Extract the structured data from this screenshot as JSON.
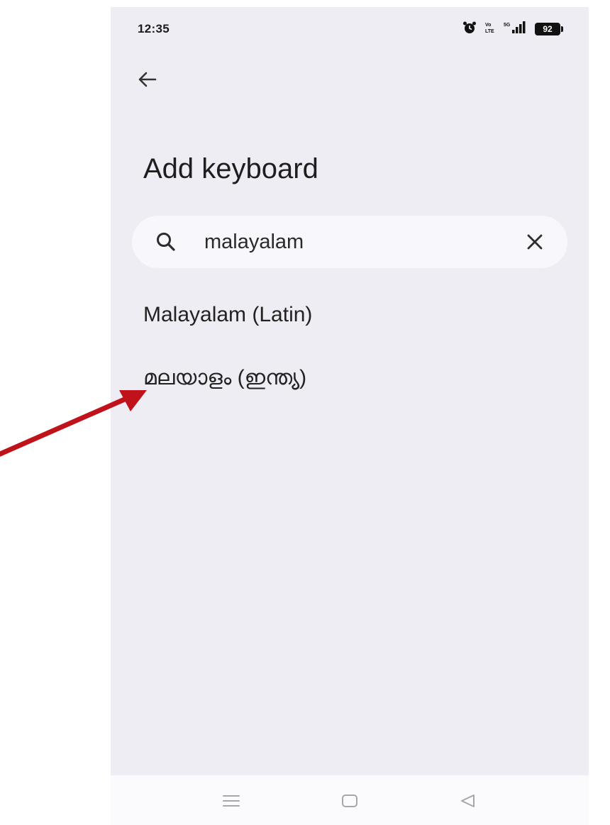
{
  "status_bar": {
    "time": "12:35",
    "battery": "92",
    "icons": [
      "alarm-icon",
      "volte-icon",
      "signal-icon",
      "battery-icon"
    ]
  },
  "header": {
    "back_icon": "arrow-left-icon",
    "title": "Add keyboard"
  },
  "search": {
    "value": "malayalam",
    "icon": "search-icon",
    "clear_icon": "close-icon"
  },
  "results": [
    {
      "label": "Malayalam (Latin)"
    },
    {
      "label": "മലയാളം (ഇന്ത്യ)"
    }
  ],
  "nav_bar": {
    "icons": [
      "menu-icon",
      "home-icon",
      "back-triangle-icon"
    ]
  },
  "annotation": {
    "color": "#c0121b"
  },
  "colors": {
    "background": "#eeedf3",
    "search_bg": "#f8f7fb",
    "text": "#222222"
  }
}
